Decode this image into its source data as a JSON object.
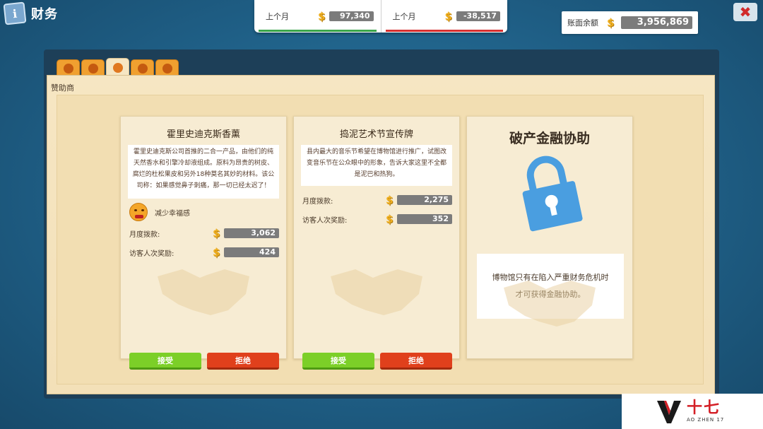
{
  "header": {
    "title": "财务",
    "title_icon": "info-book-icon",
    "close_icon": "close-icon"
  },
  "summary": {
    "income": {
      "label": "上个月",
      "value": "97,340",
      "color": "#3aa64a"
    },
    "expense": {
      "label": "上个月",
      "value": "-38,517",
      "color": "#d83030"
    }
  },
  "balance": {
    "label": "账面余额",
    "value": "3,956,869"
  },
  "tabs": [
    {
      "icon": "info-icon",
      "active": false
    },
    {
      "icon": "money-bag-icon",
      "active": false
    },
    {
      "icon": "handshake-icon",
      "active": true
    },
    {
      "icon": "dollar-icon",
      "active": false
    },
    {
      "icon": "ticket-icon",
      "active": false
    }
  ],
  "section_label": "赞助商",
  "sponsors": [
    {
      "title": "霍里史迪克斯香薰",
      "description": "霍里史迪克斯公司首推的二合一产品，由他们的纯天然香水和引擎冷却液组成。原料为昂贵的树皮、腐烂的杜松果皮和另外18种莫名其妙的材料。该公司称：如果感觉鼻子刺痛，那一切已经太迟了！",
      "penalty": "减少幸福感",
      "monthly_label": "月度拨款:",
      "monthly_value": "3,062",
      "visitor_label": "访客人次奖励:",
      "visitor_value": "424",
      "accept": "接受",
      "reject": "拒绝"
    },
    {
      "title": "捣泥艺术节宣传牌",
      "description": "县内最大的音乐节希望在博物馆进行推广，试图改变音乐节在公众眼中的形象，告诉大家这里不全都是泥巴和热狗。",
      "monthly_label": "月度拨款:",
      "monthly_value": "2,275",
      "visitor_label": "访客人次奖励:",
      "visitor_value": "352",
      "accept": "接受",
      "reject": "拒绝"
    }
  ],
  "locked": {
    "title": "破产金融协助",
    "note_line1": "博物馆只有在陷入严重财务危机时",
    "note_line2": "才可获得金融协助。",
    "lock_color": "#4a9ee0"
  },
  "watermark": {
    "cn": "十七",
    "en": "AO ZHEN 17"
  }
}
